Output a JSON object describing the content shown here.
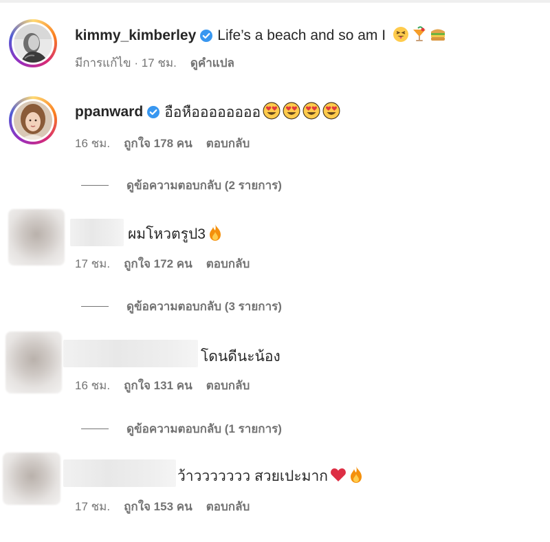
{
  "caption": {
    "username": "kimmy_kimberley",
    "text": "Life’s a beach and so am I",
    "emojis": [
      "squinting-face-with-tongue-icon",
      "tropical-drink-icon",
      "sandwich-icon"
    ],
    "edited": "มีการแก้ไข · 17 ชม.",
    "translate": "ดูคำแปล"
  },
  "comments": [
    {
      "username": "ppanward",
      "text": "อือหืออออออออ",
      "emojis": [
        "heart-eyes-icon",
        "heart-eyes-icon",
        "heart-eyes-icon",
        "heart-eyes-icon"
      ],
      "time": "16 ชม.",
      "likes": "ถูกใจ 178 คน",
      "reply": "ตอบกลับ",
      "view_replies": "ดูข้อความตอบกลับ (2 รายการ)"
    },
    {
      "text": "ผมโหวตรูป3",
      "emojis": [
        "fire-icon"
      ],
      "time": "17 ชม.",
      "likes": "ถูกใจ 172 คน",
      "reply": "ตอบกลับ",
      "view_replies": "ดูข้อความตอบกลับ (3 รายการ)"
    },
    {
      "text": "โดนดีนะน้อง",
      "time": "16 ชม.",
      "likes": "ถูกใจ 131 คน",
      "reply": "ตอบกลับ",
      "view_replies": "ดูข้อความตอบกลับ (1 รายการ)"
    },
    {
      "text": "ว้าววววววว สวยเปะมาก",
      "emojis": [
        "red-heart-icon",
        "fire-icon"
      ],
      "time": "17 ชม.",
      "likes": "ถูกใจ 153 คน",
      "reply": "ตอบกลับ"
    }
  ],
  "colors": {
    "verified": "#3897f0",
    "meta_text": "#737373",
    "primary_text": "#262626"
  }
}
